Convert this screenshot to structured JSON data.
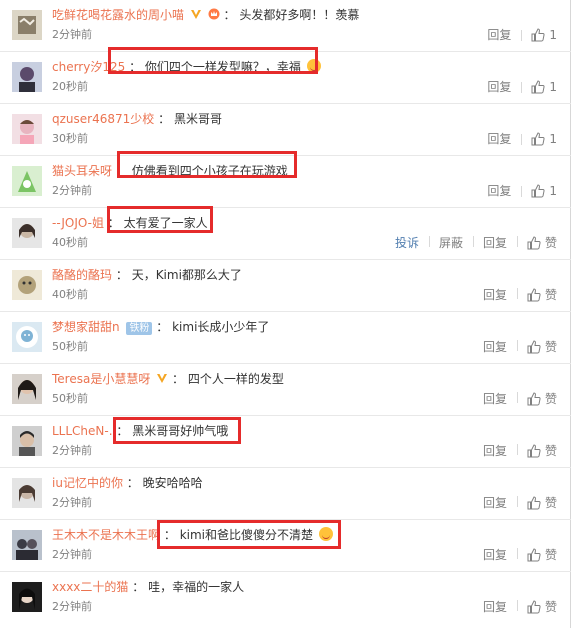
{
  "actions": {
    "report": "投诉",
    "block": "屏蔽",
    "reply": "回复",
    "like_word": "赞"
  },
  "colors": {
    "username": "#eb7350",
    "highlight": "#e52b2b",
    "link": "#507daf",
    "time": "#808080"
  },
  "comments": [
    {
      "user": "吃鲜花喝花露水的周小喵",
      "sep": "：",
      "text": "头发都好多啊！！羡慕",
      "time": "2分钟前",
      "likes": "1",
      "verified": true,
      "vip_icon": true
    },
    {
      "user": "cherry汐125",
      "sep": "：",
      "text": "你们四个一样发型嘛？，幸福",
      "time": "20秒前",
      "likes": "1",
      "emoji": true
    },
    {
      "user": "qzuser46871少校",
      "sep": "：",
      "text": "黑米哥哥",
      "time": "30秒前",
      "likes": "1"
    },
    {
      "user": "猫头耳朵呀",
      "sep": "：",
      "text": "仿佛看到四个小孩子在玩游戏",
      "time": "2分钟前",
      "likes": "1"
    },
    {
      "user": "--JOJO-姐",
      "sep": "：",
      "text": "太有爱了一家人",
      "time": "40秒前",
      "likes": "赞",
      "extra_actions": true
    },
    {
      "user": "酪酪的酪玛",
      "sep": "：",
      "text": "天，Kimi都那么大了",
      "time": "40秒前",
      "likes": "赞"
    },
    {
      "user": "梦想家甜甜n",
      "sep": "：",
      "text": "kimi长成小少年了",
      "time": "50秒前",
      "likes": "赞",
      "tag": "铁粉"
    },
    {
      "user": "Teresa是小慧慧呀",
      "sep": "：",
      "text": "四个人一样的发型",
      "time": "50秒前",
      "likes": "赞",
      "verified": true
    },
    {
      "user": "LLLCheN-.",
      "sep": "：",
      "text": "黑米哥哥好帅气哦",
      "time": "2分钟前",
      "likes": "赞"
    },
    {
      "user": "iu记忆中的你",
      "sep": "：",
      "text": "晚安哈哈哈",
      "time": "2分钟前",
      "likes": "赞"
    },
    {
      "user": "王木木不是木木王啊",
      "sep": "：",
      "text": "kimi和爸比傻傻分不清楚",
      "time": "2分钟前",
      "likes": "赞",
      "emoji": true
    },
    {
      "user": "xxxx二十的猫",
      "sep": "：",
      "text": "哇，幸福的一家人",
      "time": "2分钟前",
      "likes": "赞"
    }
  ]
}
